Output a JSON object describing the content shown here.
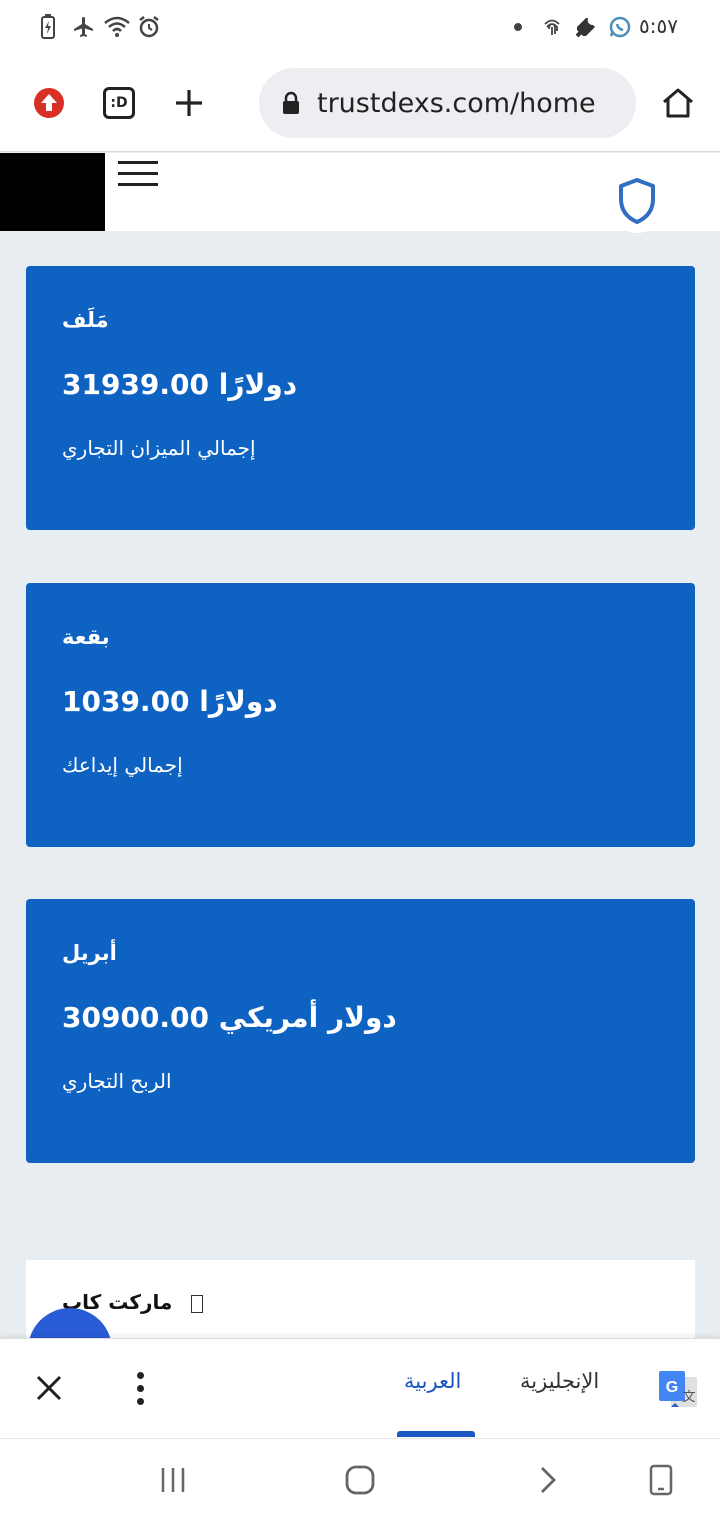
{
  "statusbar": {
    "time": "٥:٥٧",
    "icons": [
      "battery-saver-icon",
      "airplane-icon",
      "wifi-icon",
      "alarm-icon",
      "dot-icon",
      "fingerprint-icon",
      "wrench-icon",
      "whatsapp-icon"
    ]
  },
  "browser": {
    "url": "trustdexs.com/home",
    "tab_count_label": ":D"
  },
  "cards": [
    {
      "title": "مَلَف",
      "amount": "دولارًا 31939.00",
      "subtitle": "إجمالي الميزان التجاري"
    },
    {
      "title": "بقعة",
      "amount": "دولارًا 1039.00",
      "subtitle": "إجمالي إيداعك"
    },
    {
      "title": "أبريل",
      "amount": "دولار أمريكي 30900.00",
      "subtitle": "الربح التجاري"
    }
  ],
  "market": {
    "label": "ماركت كاب"
  },
  "translate": {
    "lang_target": "العربية",
    "lang_source": "الإنجليزية"
  },
  "colors": {
    "card_bg": "#0d62c2",
    "accent": "#1a56c4",
    "page_bg": "#e8edf2"
  }
}
